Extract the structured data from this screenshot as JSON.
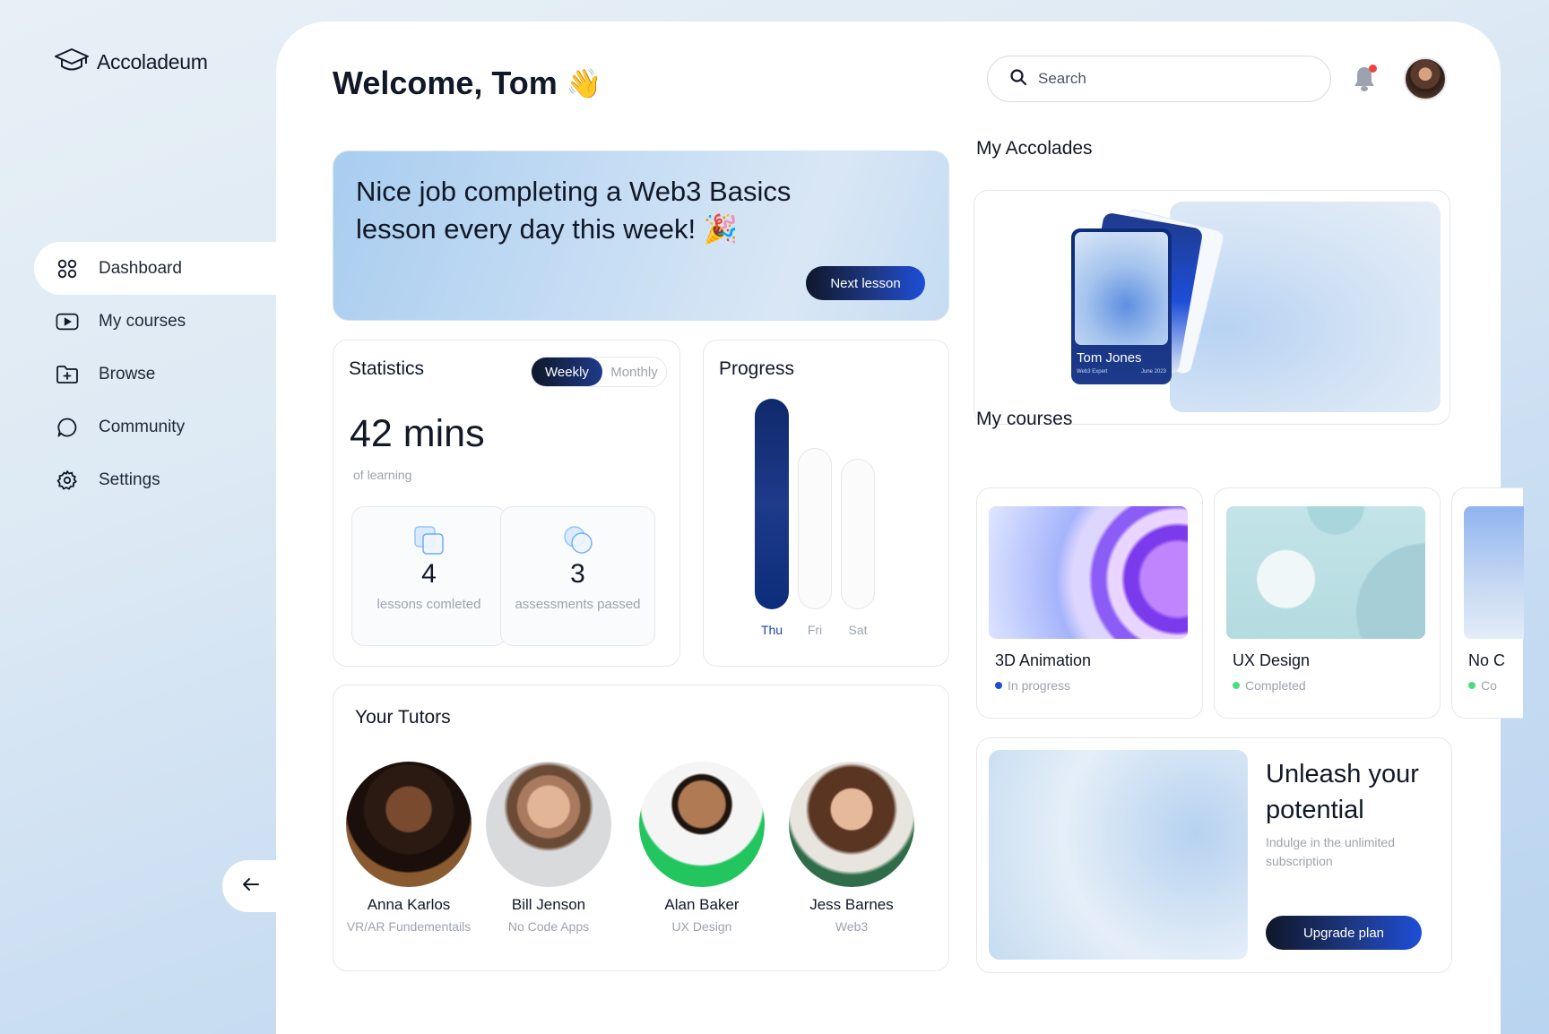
{
  "brand": {
    "name": "Accoladeum"
  },
  "sidebar": {
    "items": [
      {
        "label": "Dashboard",
        "icon": "grid-icon",
        "active": true
      },
      {
        "label": "My courses",
        "icon": "play-icon",
        "active": false
      },
      {
        "label": "Browse",
        "icon": "folder-plus-icon",
        "active": false
      },
      {
        "label": "Community",
        "icon": "chat-bubble-icon",
        "active": false
      },
      {
        "label": "Settings",
        "icon": "gear-icon",
        "active": false
      }
    ]
  },
  "header": {
    "welcome": "Welcome, Tom",
    "wave_emoji": "👋",
    "search_placeholder": "Search"
  },
  "banner": {
    "text": "Nice job completing a Web3 Basics lesson every day this week!",
    "emoji": "🎉",
    "button": "Next lesson"
  },
  "statistics": {
    "title": "Statistics",
    "toggle": [
      "Weekly",
      "Monthly"
    ],
    "selected": "Weekly",
    "minutes": "42 mins",
    "minutes_label": "of learning",
    "cards": [
      {
        "value": "4",
        "label": "lessons comleted"
      },
      {
        "value": "3",
        "label": "assessments passed"
      }
    ]
  },
  "progress": {
    "title": "Progress",
    "days": [
      {
        "label": "Thu",
        "value": 1.0,
        "active": true
      },
      {
        "label": "Fri",
        "value": 0.0,
        "active": false
      },
      {
        "label": "Sat",
        "value": 0.0,
        "active": false
      }
    ]
  },
  "tutors": {
    "title": "Your Tutors",
    "list": [
      {
        "name": "Anna Karlos",
        "subject": "VR/AR Fundementails"
      },
      {
        "name": "Bill Jenson",
        "subject": "No Code Apps"
      },
      {
        "name": "Alan Baker",
        "subject": "UX Design"
      },
      {
        "name": "Jess Barnes",
        "subject": "Web3"
      }
    ]
  },
  "accolades": {
    "title": "My Accolades",
    "card_name": "Tom Jones",
    "card_role": "Web3 Expert",
    "card_date": "June 2023"
  },
  "courses": {
    "title": "My courses",
    "list": [
      {
        "name": "3D Animation",
        "status": "In progress",
        "status_color": "#1d4ed8"
      },
      {
        "name": "UX Design",
        "status": "Completed",
        "status_color": "#4ade80"
      },
      {
        "name": "No C",
        "status": "Co",
        "status_color": "#4ade80"
      }
    ]
  },
  "upgrade": {
    "title": "Unleash your potential",
    "subtitle": "Indulge in the unlimited subscription",
    "button": "Upgrade plan"
  }
}
